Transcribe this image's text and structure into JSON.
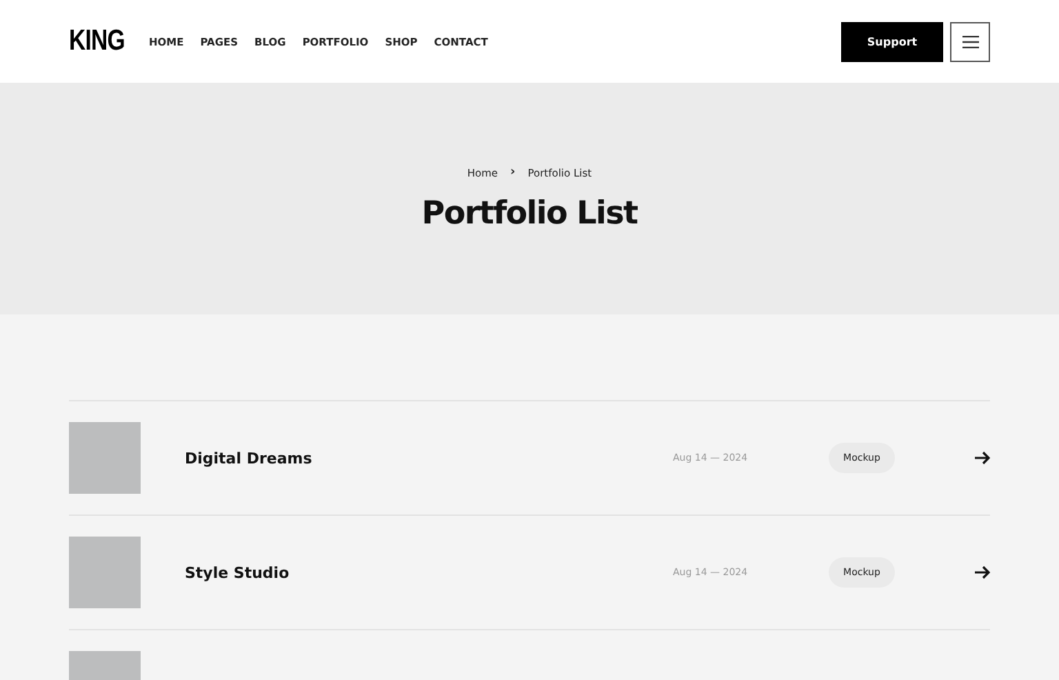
{
  "header": {
    "logo": "KING",
    "nav": [
      "HOME",
      "PAGES",
      "BLOG",
      "PORTFOLIO",
      "SHOP",
      "CONTACT"
    ],
    "support_button": "Support"
  },
  "hero": {
    "breadcrumb": [
      "Home",
      "Portfolio List"
    ],
    "breadcrumb_separator": "›",
    "title": "Portfolio List"
  },
  "portfolio": [
    {
      "kind": "full",
      "title": "Digital Dreams",
      "date": "Aug 14 — 2024",
      "tag": "Mockup"
    },
    {
      "kind": "full",
      "title": "Style Studio",
      "date": "Aug 14 — 2024",
      "tag": "Mockup"
    },
    {
      "kind": "cut"
    }
  ]
}
